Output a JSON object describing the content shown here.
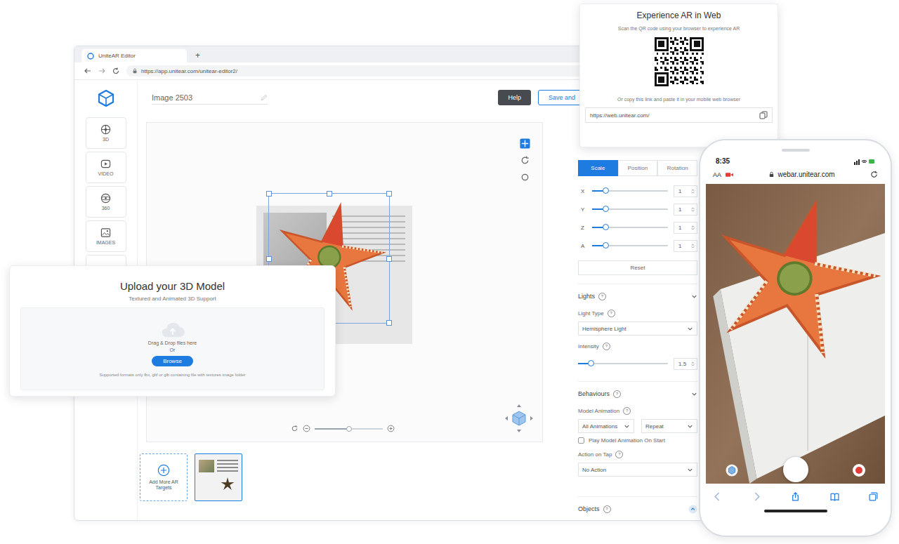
{
  "browser": {
    "tab_title": "UniteAR Editor",
    "new_tab": "+",
    "url": "https://app.unitear.com/unitear-editor2/"
  },
  "editor": {
    "title": "Image 2503",
    "help_button": "Help",
    "save_button": "Save and"
  },
  "sidebar": {
    "items": [
      {
        "label": "3D",
        "kind": "cube"
      },
      {
        "label": "VIDEO",
        "kind": "video"
      },
      {
        "label": "360",
        "kind": "pano"
      },
      {
        "label": "IMAGES",
        "kind": "images"
      }
    ]
  },
  "canvas": {
    "zoom_level": 0.5
  },
  "targets": {
    "add_label": "Add More AR Targets",
    "items": [
      {
        "selected": true
      }
    ]
  },
  "properties": {
    "help_icon": "?",
    "transform": {
      "tabs": [
        {
          "label": "Scale",
          "selected": true
        },
        {
          "label": "Position",
          "selected": false
        },
        {
          "label": "Rotation",
          "selected": false
        }
      ],
      "axes": [
        {
          "label": "X",
          "value": "1",
          "level": 0.18
        },
        {
          "label": "Y",
          "value": "1",
          "level": 0.18
        },
        {
          "label": "Z",
          "value": "1",
          "level": 0.18
        },
        {
          "label": "A",
          "value": "1",
          "level": 0.18
        }
      ],
      "reset": "Reset"
    },
    "lights": {
      "title": "Lights",
      "light_type_label": "Light Type",
      "light_type": "Hemisphere Light",
      "intensity_label": "Intensity",
      "intensity": "1.5",
      "intensity_level": 0.14
    },
    "behaviours": {
      "title": "Behaviours",
      "model_animation_label": "Model Animation",
      "animation": "All Animations",
      "loop": "Repeat",
      "play_on_start": {
        "label": "Play Model Animation On Start",
        "checked": false
      },
      "action_label": "Action on Tap",
      "action": "No Action"
    },
    "objects": {
      "title": "Objects"
    }
  },
  "upload": {
    "title": "Upload your 3D Model",
    "subtitle": "Textured and Animated 3D Support",
    "drop_text": "Drag & Drop files here",
    "or": "Or",
    "browse": "Browse",
    "note": "Supported formats only fbx, gltf or glb containing file with textures image folder"
  },
  "web_ar": {
    "title": "Experience AR in Web",
    "instruction": "Scan the QR code using your browser to experience AR",
    "or_copy": "Or copy this link and paste it in your mobile web browser",
    "link": "https://web.unitear.com/"
  },
  "phone": {
    "time": "8:35",
    "text_size": "AA",
    "url": "webar.unitear.com"
  }
}
